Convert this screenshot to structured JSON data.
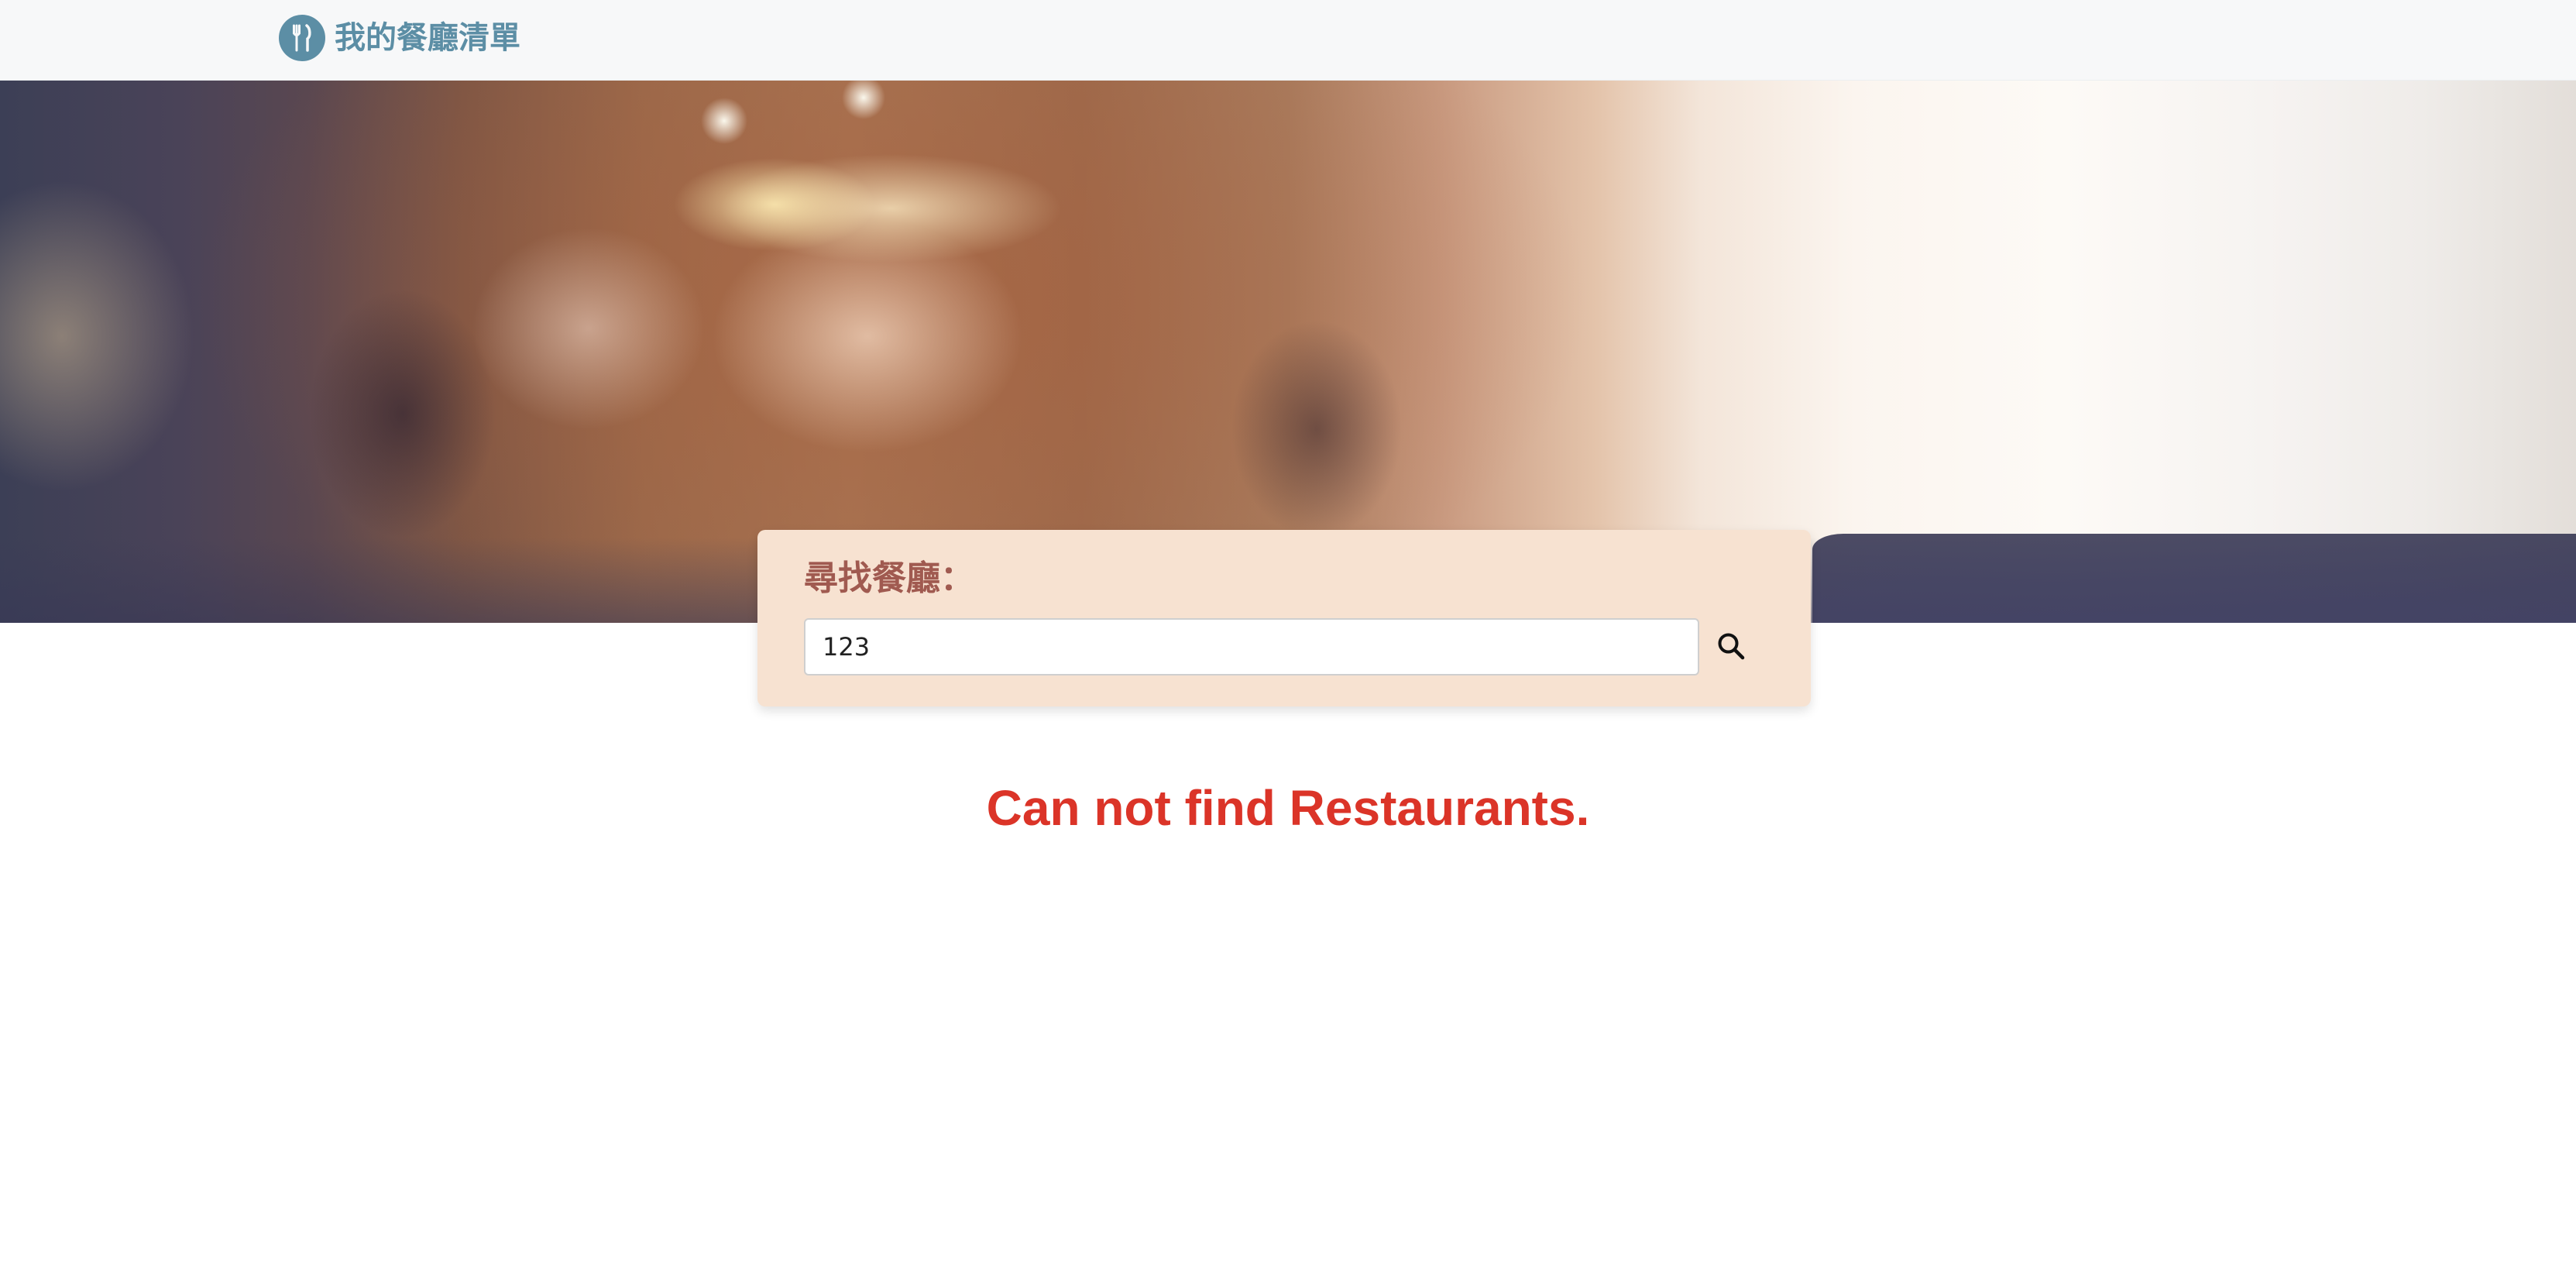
{
  "navbar": {
    "brand_icon": "fork-knife-icon",
    "brand_label": "我的餐廳清單"
  },
  "banner": {
    "image": "blurred-restaurant-interior-photo"
  },
  "search": {
    "title": "尋找餐廳：",
    "value": "123",
    "button_icon": "search-icon"
  },
  "results": {
    "empty_message": "Can not find Restaurants."
  },
  "colors": {
    "brand": "#5c8ea5",
    "card_background": "#f7e2d1",
    "search_title": "#a05a50",
    "error_text": "#db3428"
  }
}
